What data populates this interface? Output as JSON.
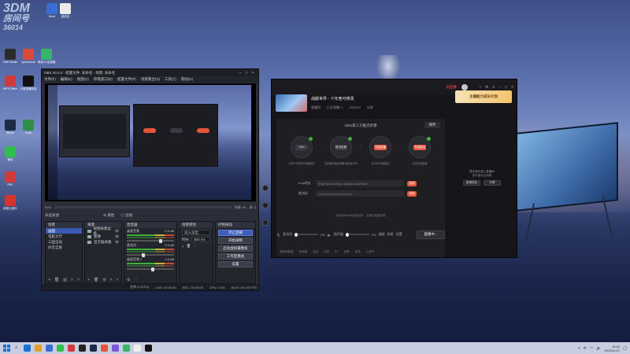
{
  "watermark": {
    "line1": "3DM",
    "line2": "房间号",
    "line3": "36014"
  },
  "desktop_icons": [
    {
      "label": "OBS Studio",
      "color": "#2b2b2b"
    },
    {
      "label": "Apowersoft",
      "color": "#d94a3a"
    },
    {
      "label": "网易UU加速器",
      "color": "#38b56a"
    },
    {
      "label": "回收站",
      "color": "#eaeaea"
    },
    {
      "label": "Word",
      "color": "#3a6fd1"
    },
    {
      "label": "WPS Office",
      "color": "#d13a3a"
    },
    {
      "label": "抖音直播伴侣",
      "color": "#111"
    },
    {
      "label": "PDF",
      "color": "#d13a3a"
    },
    {
      "label": "Steam",
      "color": "#1b2b45"
    },
    {
      "label": "Excel",
      "color": "#2f8f45"
    },
    {
      "label": "微信",
      "color": "#2fbf4f"
    },
    {
      "label": "网易云音乐",
      "color": "#d4342b"
    }
  ],
  "obs": {
    "title": "OBS 30.0.2 - 配置文件: 未命名 - 场景: 未命名",
    "menu": [
      "文件(F)",
      "编辑(E)",
      "视图(V)",
      "停靠窗口(D)",
      "配置文件(P)",
      "场景集合(S)",
      "工具(T)",
      "帮助(H)"
    ],
    "preview_status": [
      "50%",
      "帧数: 60",
      "源: 0"
    ],
    "source_bar": [
      "未选择源",
      "属性",
      "滤镜"
    ],
    "scenes": {
      "header": "场景",
      "items": [
        "画面",
        "电影大厅",
        "三国全站",
        "抖音全屏"
      ],
      "selected": 0
    },
    "sources": {
      "header": "来源",
      "items": [
        "视频采集设备",
        "图像",
        "显示器采集"
      ]
    },
    "mixer": {
      "header": "混音器",
      "channels": [
        {
          "name": "桌面音频",
          "db": "0.0 dB",
          "level": 0.72
        },
        {
          "name": "麦克风",
          "db": "0.0 dB",
          "level": 0.35
        },
        {
          "name": "桌面音频 2",
          "db": "0.0 dB",
          "level": 0.55
        }
      ]
    },
    "transitions": {
      "header": "场景转场",
      "selected": "淡入淡出",
      "duration_label": "时长",
      "duration": "300 ms"
    },
    "controls": {
      "header": "控制按钮",
      "buttons": [
        "停止直播",
        "开始录制",
        "启动虚拟摄像机",
        "工作室模式",
        "设置",
        "退出"
      ]
    },
    "statusbar": [
      "丢帧 0 (0.0%)",
      "LIVE: 00:00:00",
      "REC: 00:00:00",
      "CPU: 0.4%",
      "60.00 / 60.00 FPS"
    ]
  },
  "douyin": {
    "live_button": "去直播",
    "room_title": "战舰世界 - 十年舍可修改",
    "meta": [
      "直播间",
      "已开直播: 0",
      "2023/12",
      "分享"
    ],
    "banner": "主播能力成长计划",
    "panel_caption": "OBS第三方推流步骤",
    "save_label": "保存",
    "steps": [
      {
        "inner": "OBS",
        "label": "打开OBS软件设置推流",
        "done": true
      },
      {
        "inner": "推流设置",
        "label": "复制推流地址和推流码到OBS",
        "done": true
      },
      {
        "inner": "开始直播",
        "label": "在OBS开始推流",
        "done": false
      },
      {
        "inner": "开始推流",
        "label": "点击开始直播",
        "done": true
      }
    ],
    "addr_label": "rtmp地址",
    "addr_value": "rtmp://push-rtmp-f.douyin.com/third",
    "key_label": "推流码",
    "key_value": "•••••••••••••••••••••••••••••••",
    "copy_label": "复制",
    "note": "未使用rtmp地址推流时，会提示直播中断",
    "controls": [
      "麦克风",
      "0%",
      "扬声器",
      "0%",
      "美颜",
      "贴纸",
      "设置"
    ],
    "start_label": "直播中...",
    "bottom": [
      "直播间数据",
      "粉丝团",
      "连线",
      "礼物",
      "PK",
      "投票",
      "商品",
      "小游戏"
    ],
    "side_text": [
      "暂无观众进入直播间",
      "多与观众互动吧"
    ],
    "side_buttons": [
      "邀请好友",
      "分享"
    ]
  },
  "taskbar": {
    "search_icon": "search-icon",
    "apps": [
      "#1b6fd1",
      "#e0a12b",
      "#3a6fd1",
      "#2fbf4f",
      "#d13a3a",
      "#222",
      "#1b2b45",
      "#e5553c",
      "#7a5ad8",
      "#38b56a",
      "#f0f0f0",
      "#111"
    ],
    "tray_label": "中",
    "time": "16:22",
    "date": "2023/11/17"
  }
}
